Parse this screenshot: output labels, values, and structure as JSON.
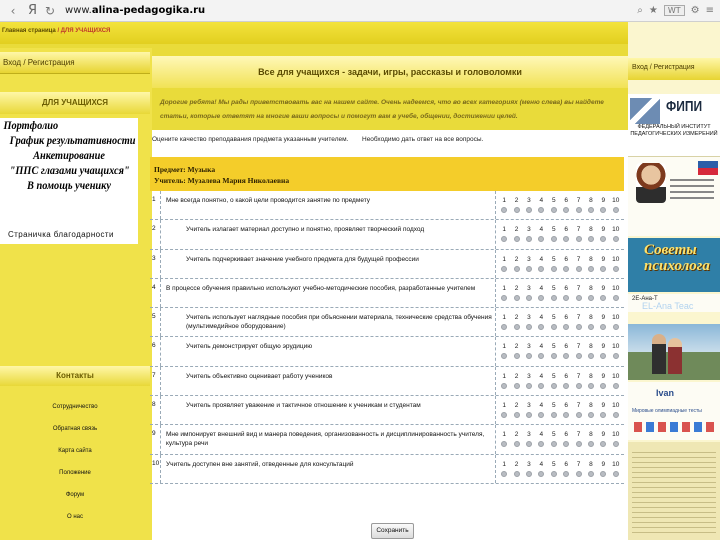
{
  "browser": {
    "yandex_label": "Я",
    "url_host": "www.",
    "url_domain": "alina-pedagogika.ru",
    "wt_badge": "WT"
  },
  "breadcrumb": {
    "home": "Главная страница",
    "separator": "/",
    "current": "ДЛЯ УЧАЩИХСЯ"
  },
  "left": {
    "login": "Вход / Регистрация",
    "section_title": "ДЛЯ УЧАЩИХСЯ",
    "popup_items": [
      "Портфолио",
      "График результативности",
      "Анкетирование",
      "\"ППС глазами учащихся\"",
      "В помощь ученику"
    ],
    "thanks": "Страничка благодарности",
    "contacts_title": "Контакты",
    "links": [
      "Сотрудничество",
      "Обратная связь",
      "Карта сайта",
      "Положение",
      "Форум",
      "О нас"
    ]
  },
  "main": {
    "title": "Все для учащихся - задачи, игры, рассказы и головоломки",
    "intro": "Дорогие ребята! Мы рады приветствовать вас на нашем сайте. Очень надеемся, что во всех категориях (меню слева) вы найдете статьи, которые ответят на многие ваши вопросы и помогут вам в учебе, общении, достижении целей.",
    "instruction_left": "Оцените качество преподавания предмета указанным учителем.",
    "instruction_right": "Необходимо дать ответ на все вопросы.",
    "subject": "Предмет: Музыка",
    "teacher": "Учитель: Музалева Мария Николаевна",
    "scale": [
      "1",
      "2",
      "3",
      "4",
      "5",
      "6",
      "7",
      "8",
      "9",
      "10"
    ],
    "questions": [
      {
        "num": "1",
        "text": "Мне всегда понятно, о какой цели проводится занятие по предмету"
      },
      {
        "num": "2",
        "text": "Учитель излагает материал доступно и понятно, проявляет творческий подход"
      },
      {
        "num": "3",
        "text": "Учитель подчеркивает значение учебного предмета для будущей профессии"
      },
      {
        "num": "4",
        "text": "В процессе обучения правильно используют учебно-методические пособия, разработанные учителем"
      },
      {
        "num": "5",
        "text": "Учитель использует наглядные пособия при объяснении материала, технические средства обучения (мультимедийное оборудование)"
      },
      {
        "num": "6",
        "text": "Учитель демонстрирует общую эрудицию"
      },
      {
        "num": "7",
        "text": "Учитель объективно оценивает работу учеников"
      },
      {
        "num": "8",
        "text": "Учитель проявляет уважение и тактичное отношение к ученикам и студентам"
      },
      {
        "num": "9",
        "text": "Мне импонирует внешний вид и манера поведения, организованность и дисциплинированность учителя, культура речи"
      },
      {
        "num": "10",
        "text": "Учитель доступен вне занятий, отведенные для консультаций"
      }
    ],
    "save": "Сохранить"
  },
  "right": {
    "login": "Вход / Регистрация",
    "fipi_title": "ФИПИ",
    "fipi_sub": "ФЕДЕРАЛЬНЫЙ ИНСТИТУТ ПЕДАГОГИЧЕСКИХ ИЗМЕРЕНИЙ",
    "sovety_line1": "Советы",
    "sovety_line2": "психолога",
    "el_ana_small": "2Е-Ана-Т",
    "el_ana_big": "EL-Ana Teac",
    "banner3_title": "Ivan",
    "banner3_sub": "Мировые олимпиадные тесты"
  }
}
